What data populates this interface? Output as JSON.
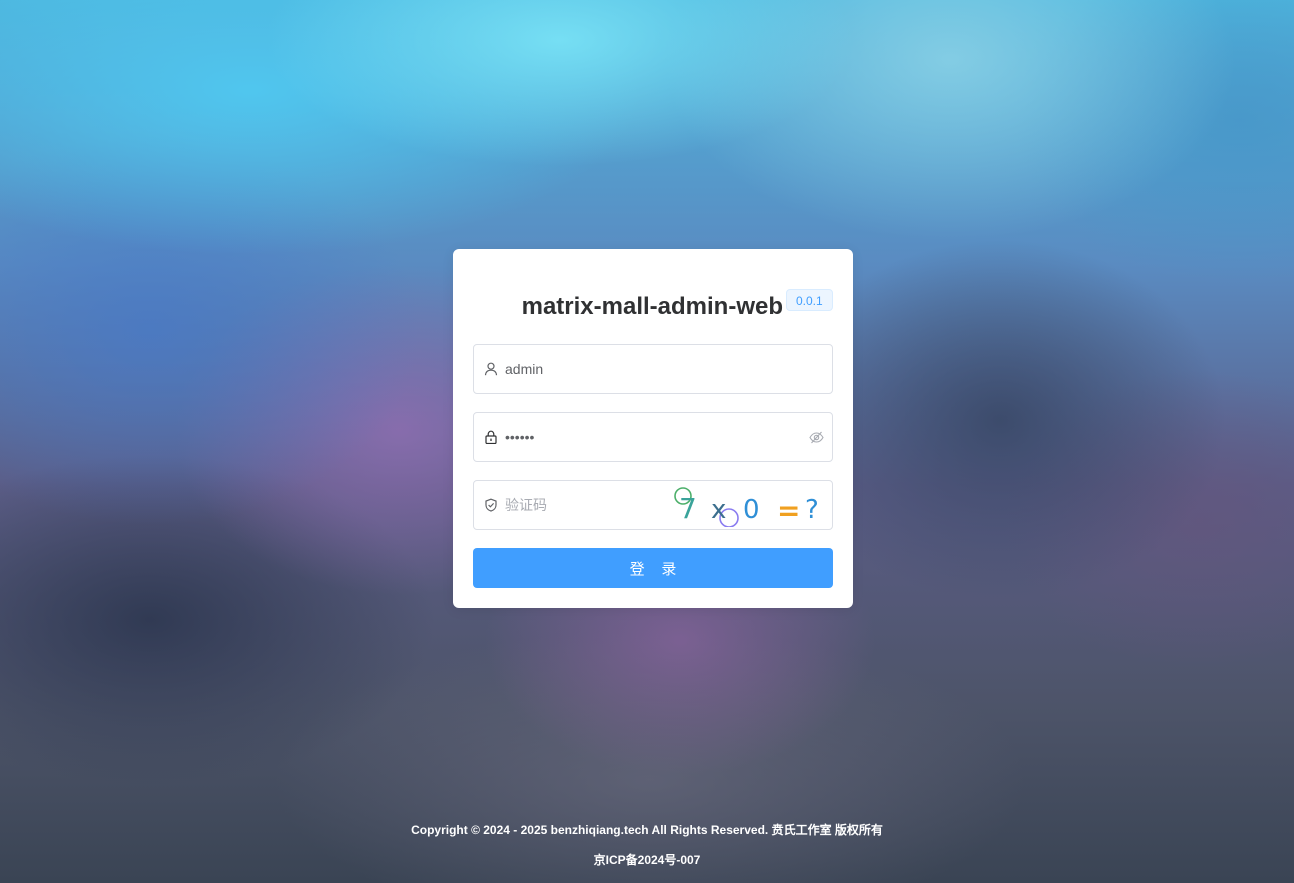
{
  "app": {
    "title": "matrix-mall-admin-web",
    "version": "0.0.1"
  },
  "form": {
    "username": {
      "icon": "user-icon",
      "value": "admin",
      "placeholder": ""
    },
    "password": {
      "icon": "lock-icon",
      "value": "123456",
      "toggle_icon": "eye-off-icon"
    },
    "captcha": {
      "icon": "shield-icon",
      "placeholder": "验证码",
      "value": "",
      "image": {
        "text": [
          "7",
          "x",
          "0",
          "=",
          "?"
        ],
        "colors": [
          "#3aa39a",
          "#3c6f8e",
          "#2f8fd6",
          "#f0a020",
          "#2f8fd6"
        ]
      }
    },
    "submit_label": "登 录"
  },
  "footer": {
    "copyright": "Copyright © 2024 - 2025 benzhiqiang.tech All Rights Reserved. 贲氏工作室 版权所有",
    "icp": "京ICP备2024号-007"
  },
  "colors": {
    "primary": "#409eff",
    "badge_bg": "#ecf5ff",
    "title_text": "#303133"
  }
}
